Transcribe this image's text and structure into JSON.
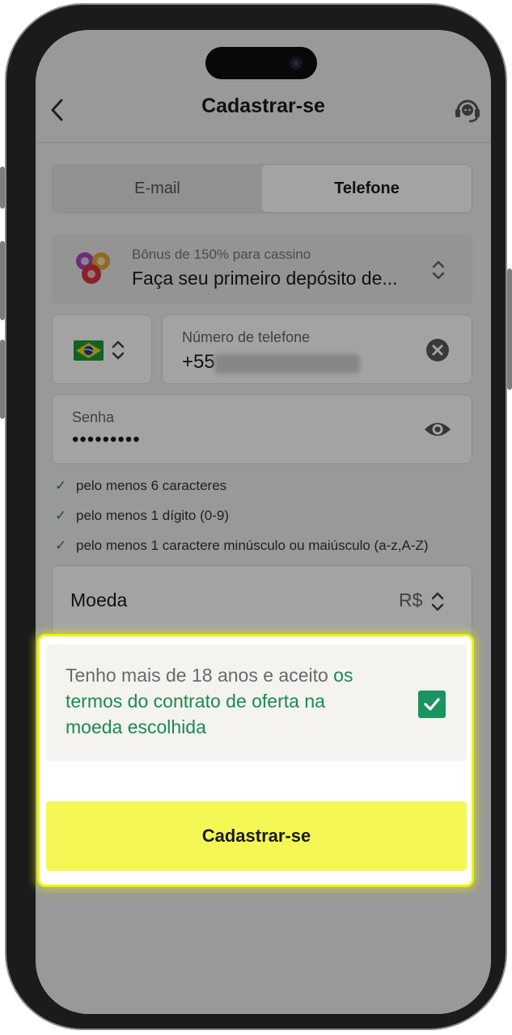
{
  "header": {
    "title": "Cadastrar-se"
  },
  "tabs": [
    {
      "label": "E-mail"
    },
    {
      "label": "Telefone"
    }
  ],
  "bonus": {
    "subtitle": "Bônus de 150% para cassino",
    "title": "Faça seu primeiro depósito de..."
  },
  "phone": {
    "label": "Número de telefone",
    "prefix": "+55"
  },
  "password": {
    "label": "Senha",
    "value": "•••••••••"
  },
  "rules": [
    {
      "text": "pelo menos 6 caracteres"
    },
    {
      "text": "pelo menos 1 dígito (0-9)"
    },
    {
      "text": "pelo menos 1 caractere minúsculo ou maiúsculo (a-z,A-Z)"
    }
  ],
  "currency": {
    "label": "Moeda",
    "value": "R$"
  },
  "terms": {
    "text": "Tenho mais de 18 anos e aceito ",
    "link": "os termos do contrato de oferta na moeda escolhida",
    "checked": true
  },
  "submit": {
    "label": "Cadastrar-se"
  },
  "colors": {
    "accent_green": "#1a9460",
    "highlight_yellow": "#ecf400",
    "submit_yellow": "#f5f854"
  },
  "icons": {
    "back": "chevron-left-icon",
    "support": "headset-icon",
    "clear": "close-circle-icon",
    "eye": "eye-icon",
    "check": "check-icon"
  }
}
